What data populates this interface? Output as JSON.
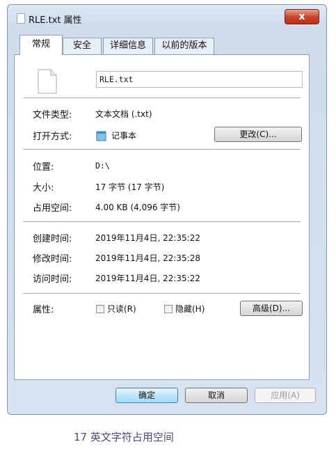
{
  "window": {
    "title": "RLE.txt 属性",
    "close_label": "x"
  },
  "tabs": [
    {
      "label": "常规",
      "active": true
    },
    {
      "label": "安全"
    },
    {
      "label": "详细信息"
    },
    {
      "label": "以前的版本"
    }
  ],
  "file": {
    "name": "RLE.txt"
  },
  "info": {
    "type_label": "文件类型:",
    "type_value": "文本文档 (.txt)",
    "open_label": "打开方式:",
    "open_value": "记事本",
    "change_button": "更改(C)...",
    "location_label": "位置:",
    "location_value": "D:\\",
    "size_label": "大小:",
    "size_value": "17 字节 (17 字节)",
    "disk_label": "占用空间:",
    "disk_value": "4.00 KB (4,096 字节)",
    "created_label": "创建时间:",
    "created_value": "2019年11月4日, 22:35:22",
    "modified_label": "修改时间:",
    "modified_value": "2019年11月4日, 22:35:28",
    "accessed_label": "访问时间:",
    "accessed_value": "2019年11月4日, 22:35:22"
  },
  "attributes": {
    "label": "属性:",
    "readonly": "只读(R)",
    "hidden": "隐藏(H)",
    "advanced_button": "高级(D)..."
  },
  "footer": {
    "ok": "确定",
    "cancel": "取消",
    "apply": "应用(A)"
  },
  "caption": "17 英文字符占用空间"
}
